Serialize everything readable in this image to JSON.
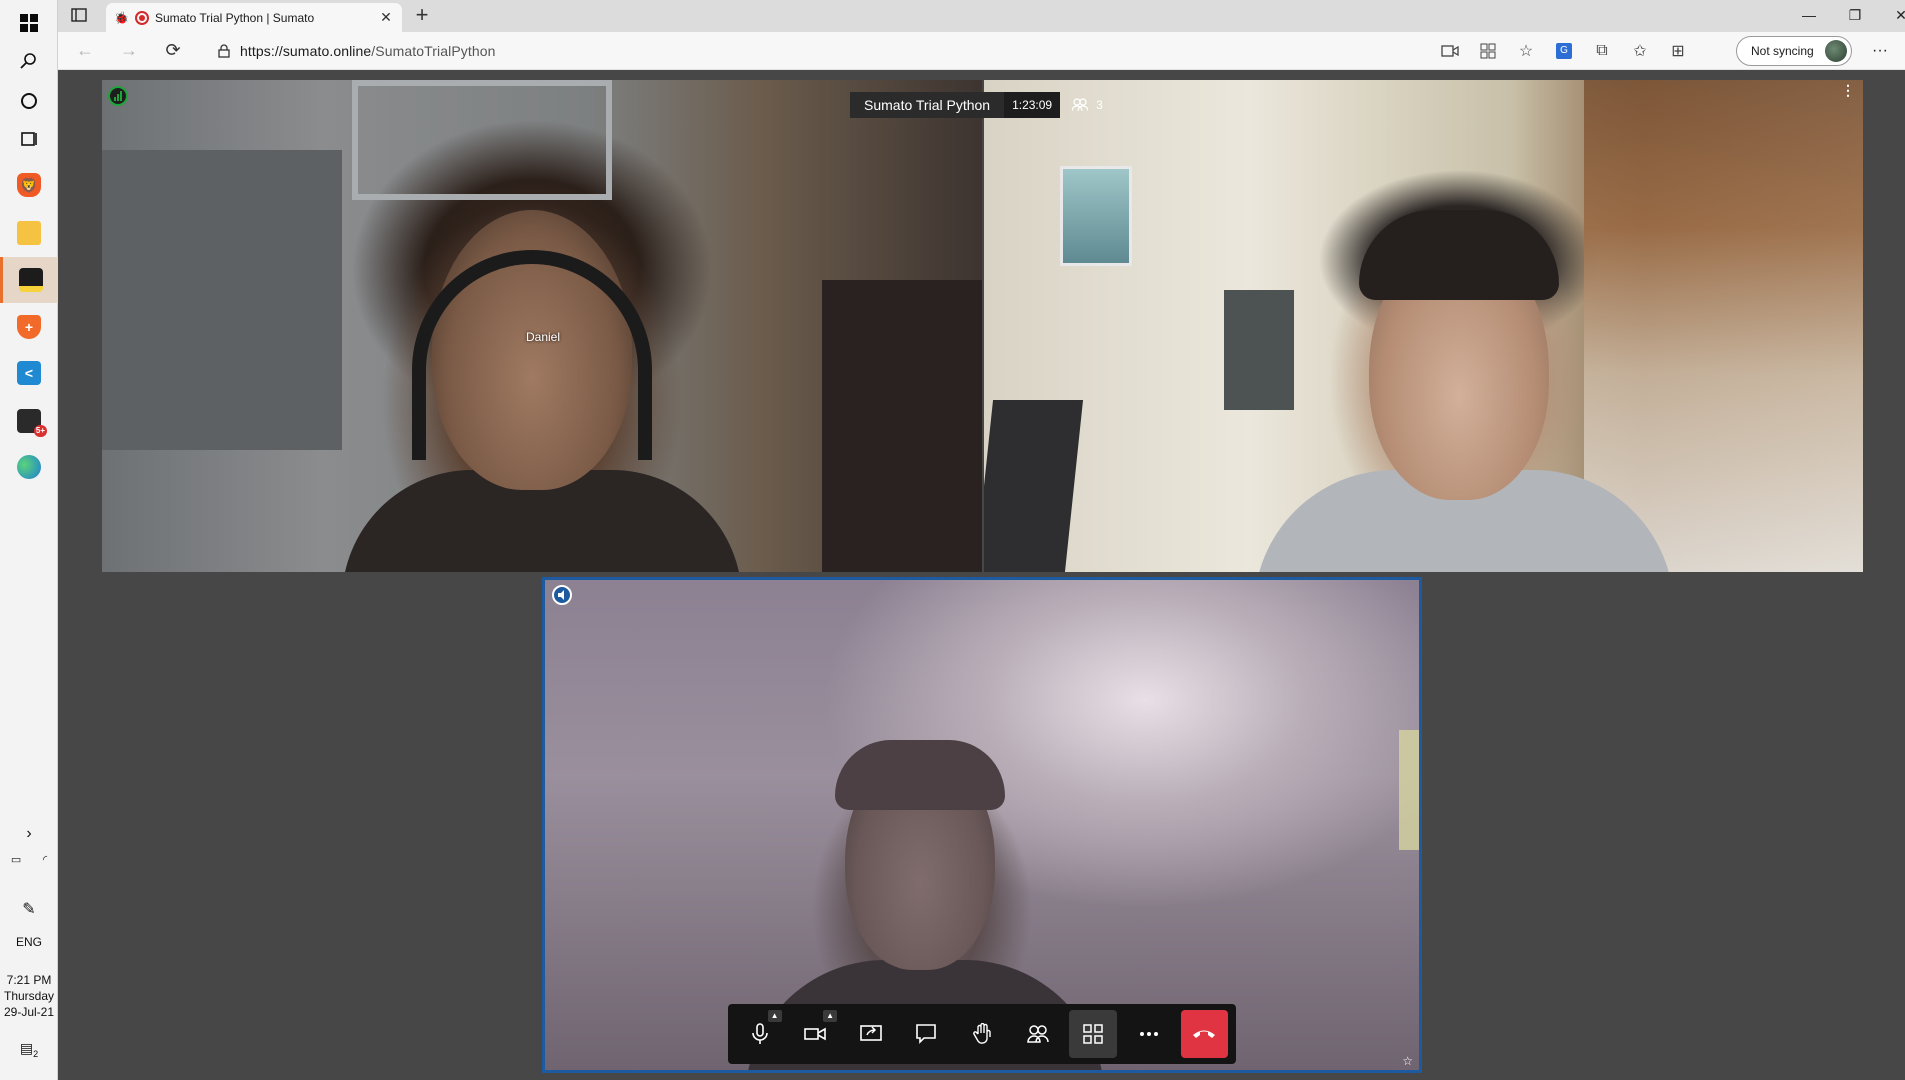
{
  "browser": {
    "tab_title": "Sumato Trial Python | Sumato",
    "url_host": "https://sumato.online",
    "url_path": "/SumatoTrialPython",
    "sync_label": "Not syncing"
  },
  "meeting": {
    "title": "Sumato Trial Python",
    "timer": "1:23:09",
    "participant_count": "3"
  },
  "participants": [
    {
      "name": "Daniel"
    }
  ],
  "taskbar": {
    "language": "ENG",
    "time": "7:21 PM",
    "day": "Thursday",
    "date": "29-Jul-21",
    "notification_count": "2",
    "app_badge": "5+"
  },
  "colors": {
    "hangup": "#e03443",
    "speaker_border": "#1e5aa0",
    "audio_indicator": "#1fa33a"
  }
}
